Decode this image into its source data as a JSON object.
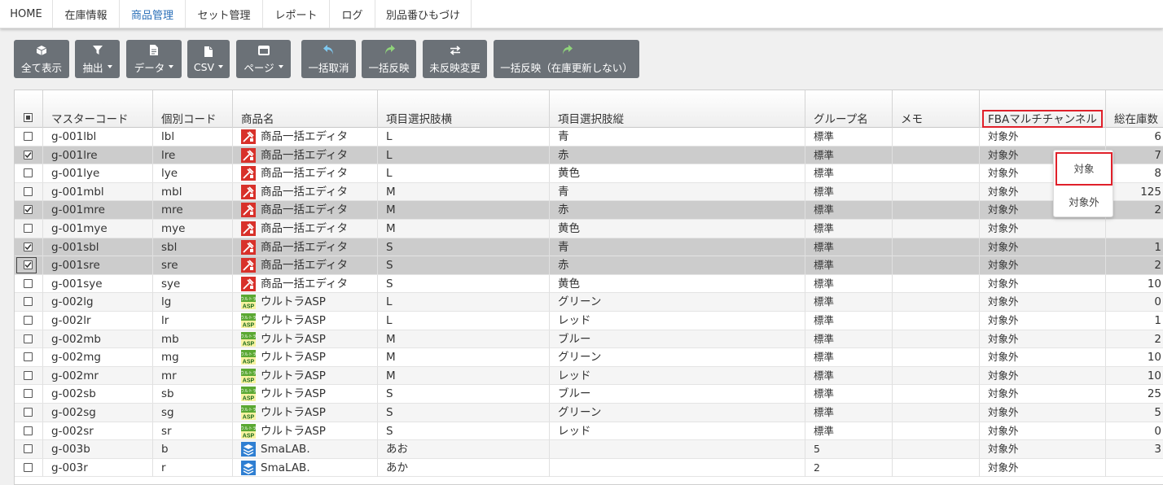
{
  "nav": {
    "items": [
      {
        "label": "HOME"
      },
      {
        "label": "在庫情報"
      },
      {
        "label": "商品管理",
        "active": true
      },
      {
        "label": "セット管理"
      },
      {
        "label": "レポート"
      },
      {
        "label": "ログ"
      },
      {
        "label": "別品番ひもづけ"
      }
    ]
  },
  "toolbar": {
    "show_all": "全て表示",
    "extract": "抽出",
    "data": "データ",
    "csv": "CSV",
    "page": "ページ",
    "bulk_cancel": "一括取消",
    "bulk_apply": "一括反映",
    "unapplied_change": "未反映変更",
    "bulk_apply_no_stock": "一括反映（在庫更新しない）"
  },
  "table": {
    "headers": {
      "master_code": "マスターコード",
      "item_code": "個別コード",
      "product_name": "商品名",
      "option_h": "項目選択肢横",
      "option_v": "項目選択肢縦",
      "group": "グループ名",
      "memo": "メモ",
      "fba": "FBAマルチチャンネル",
      "stock": "総在庫数"
    },
    "rows": [
      {
        "master": "g-001lbl",
        "code": "lbl",
        "name": "商品一括エディタ",
        "logo": "editor",
        "h": "L",
        "v": "青",
        "group": "標準",
        "memo": "",
        "fba": "対象外",
        "stock": "6",
        "checked": false
      },
      {
        "master": "g-001lre",
        "code": "lre",
        "name": "商品一括エディタ",
        "logo": "editor",
        "h": "L",
        "v": "赤",
        "group": "標準",
        "memo": "",
        "fba": "対象外",
        "stock": "7",
        "checked": true
      },
      {
        "master": "g-001lye",
        "code": "lye",
        "name": "商品一括エディタ",
        "logo": "editor",
        "h": "L",
        "v": "黄色",
        "group": "標準",
        "memo": "",
        "fba": "対象外",
        "stock": "8",
        "checked": false
      },
      {
        "master": "g-001mbl",
        "code": "mbl",
        "name": "商品一括エディタ",
        "logo": "editor",
        "h": "M",
        "v": "青",
        "group": "標準",
        "memo": "",
        "fba": "対象外",
        "stock": "125",
        "checked": false
      },
      {
        "master": "g-001mre",
        "code": "mre",
        "name": "商品一括エディタ",
        "logo": "editor",
        "h": "M",
        "v": "赤",
        "group": "標準",
        "memo": "",
        "fba": "対象外",
        "stock": "2",
        "checked": true
      },
      {
        "master": "g-001mye",
        "code": "mye",
        "name": "商品一括エディタ",
        "logo": "editor",
        "h": "M",
        "v": "黄色",
        "group": "標準",
        "memo": "",
        "fba": "対象外",
        "stock": "",
        "checked": false
      },
      {
        "master": "g-001sbl",
        "code": "sbl",
        "name": "商品一括エディタ",
        "logo": "editor",
        "h": "S",
        "v": "青",
        "group": "標準",
        "memo": "",
        "fba": "対象外",
        "stock": "1",
        "checked": true
      },
      {
        "master": "g-001sre",
        "code": "sre",
        "name": "商品一括エディタ",
        "logo": "editor",
        "h": "S",
        "v": "赤",
        "group": "標準",
        "memo": "",
        "fba": "対象外",
        "stock": "2",
        "checked": true,
        "focus": true
      },
      {
        "master": "g-001sye",
        "code": "sye",
        "name": "商品一括エディタ",
        "logo": "editor",
        "h": "S",
        "v": "黄色",
        "group": "標準",
        "memo": "",
        "fba": "対象外",
        "stock": "10",
        "checked": false
      },
      {
        "master": "g-002lg",
        "code": "lg",
        "name": "ウルトラASP",
        "logo": "asp",
        "h": "L",
        "v": "グリーン",
        "group": "標準",
        "memo": "",
        "fba": "対象外",
        "stock": "0",
        "checked": false
      },
      {
        "master": "g-002lr",
        "code": "lr",
        "name": "ウルトラASP",
        "logo": "asp",
        "h": "L",
        "v": "レッド",
        "group": "標準",
        "memo": "",
        "fba": "対象外",
        "stock": "1",
        "checked": false
      },
      {
        "master": "g-002mb",
        "code": "mb",
        "name": "ウルトラASP",
        "logo": "asp",
        "h": "M",
        "v": "ブルー",
        "group": "標準",
        "memo": "",
        "fba": "対象外",
        "stock": "2",
        "checked": false
      },
      {
        "master": "g-002mg",
        "code": "mg",
        "name": "ウルトラASP",
        "logo": "asp",
        "h": "M",
        "v": "グリーン",
        "group": "標準",
        "memo": "",
        "fba": "対象外",
        "stock": "10",
        "checked": false
      },
      {
        "master": "g-002mr",
        "code": "mr",
        "name": "ウルトラASP",
        "logo": "asp",
        "h": "M",
        "v": "レッド",
        "group": "標準",
        "memo": "",
        "fba": "対象外",
        "stock": "10",
        "checked": false
      },
      {
        "master": "g-002sb",
        "code": "sb",
        "name": "ウルトラASP",
        "logo": "asp",
        "h": "S",
        "v": "ブルー",
        "group": "標準",
        "memo": "",
        "fba": "対象外",
        "stock": "25",
        "checked": false
      },
      {
        "master": "g-002sg",
        "code": "sg",
        "name": "ウルトラASP",
        "logo": "asp",
        "h": "S",
        "v": "グリーン",
        "group": "標準",
        "memo": "",
        "fba": "対象外",
        "stock": "5",
        "checked": false
      },
      {
        "master": "g-002sr",
        "code": "sr",
        "name": "ウルトラASP",
        "logo": "asp",
        "h": "S",
        "v": "レッド",
        "group": "標準",
        "memo": "",
        "fba": "対象外",
        "stock": "0",
        "checked": false
      },
      {
        "master": "g-003b",
        "code": "b",
        "name": "SmaLAB.",
        "logo": "smalab",
        "h": "あお",
        "v": "",
        "group": "5",
        "memo": "",
        "fba": "対象外",
        "stock": "3",
        "checked": false
      },
      {
        "master": "g-003r",
        "code": "r",
        "name": "SmaLAB.",
        "logo": "smalab",
        "h": "あか",
        "v": "",
        "group": "2",
        "memo": "",
        "fba": "対象外",
        "stock": "",
        "checked": false
      }
    ]
  },
  "fba_dropdown": {
    "options": [
      "対象",
      "対象外"
    ],
    "highlighted": "対象"
  },
  "logos": {
    "asp_text_top": "ウルトラ",
    "asp_text": "ASP"
  },
  "colors": {
    "active_nav": "#2a6fb8",
    "toolbar_button": "#6b7177",
    "highlight_red": "#e0202a",
    "selected_row": "#cccccc",
    "undo_icon": "#7ec8f0",
    "redo_icon": "#8fd37a"
  }
}
